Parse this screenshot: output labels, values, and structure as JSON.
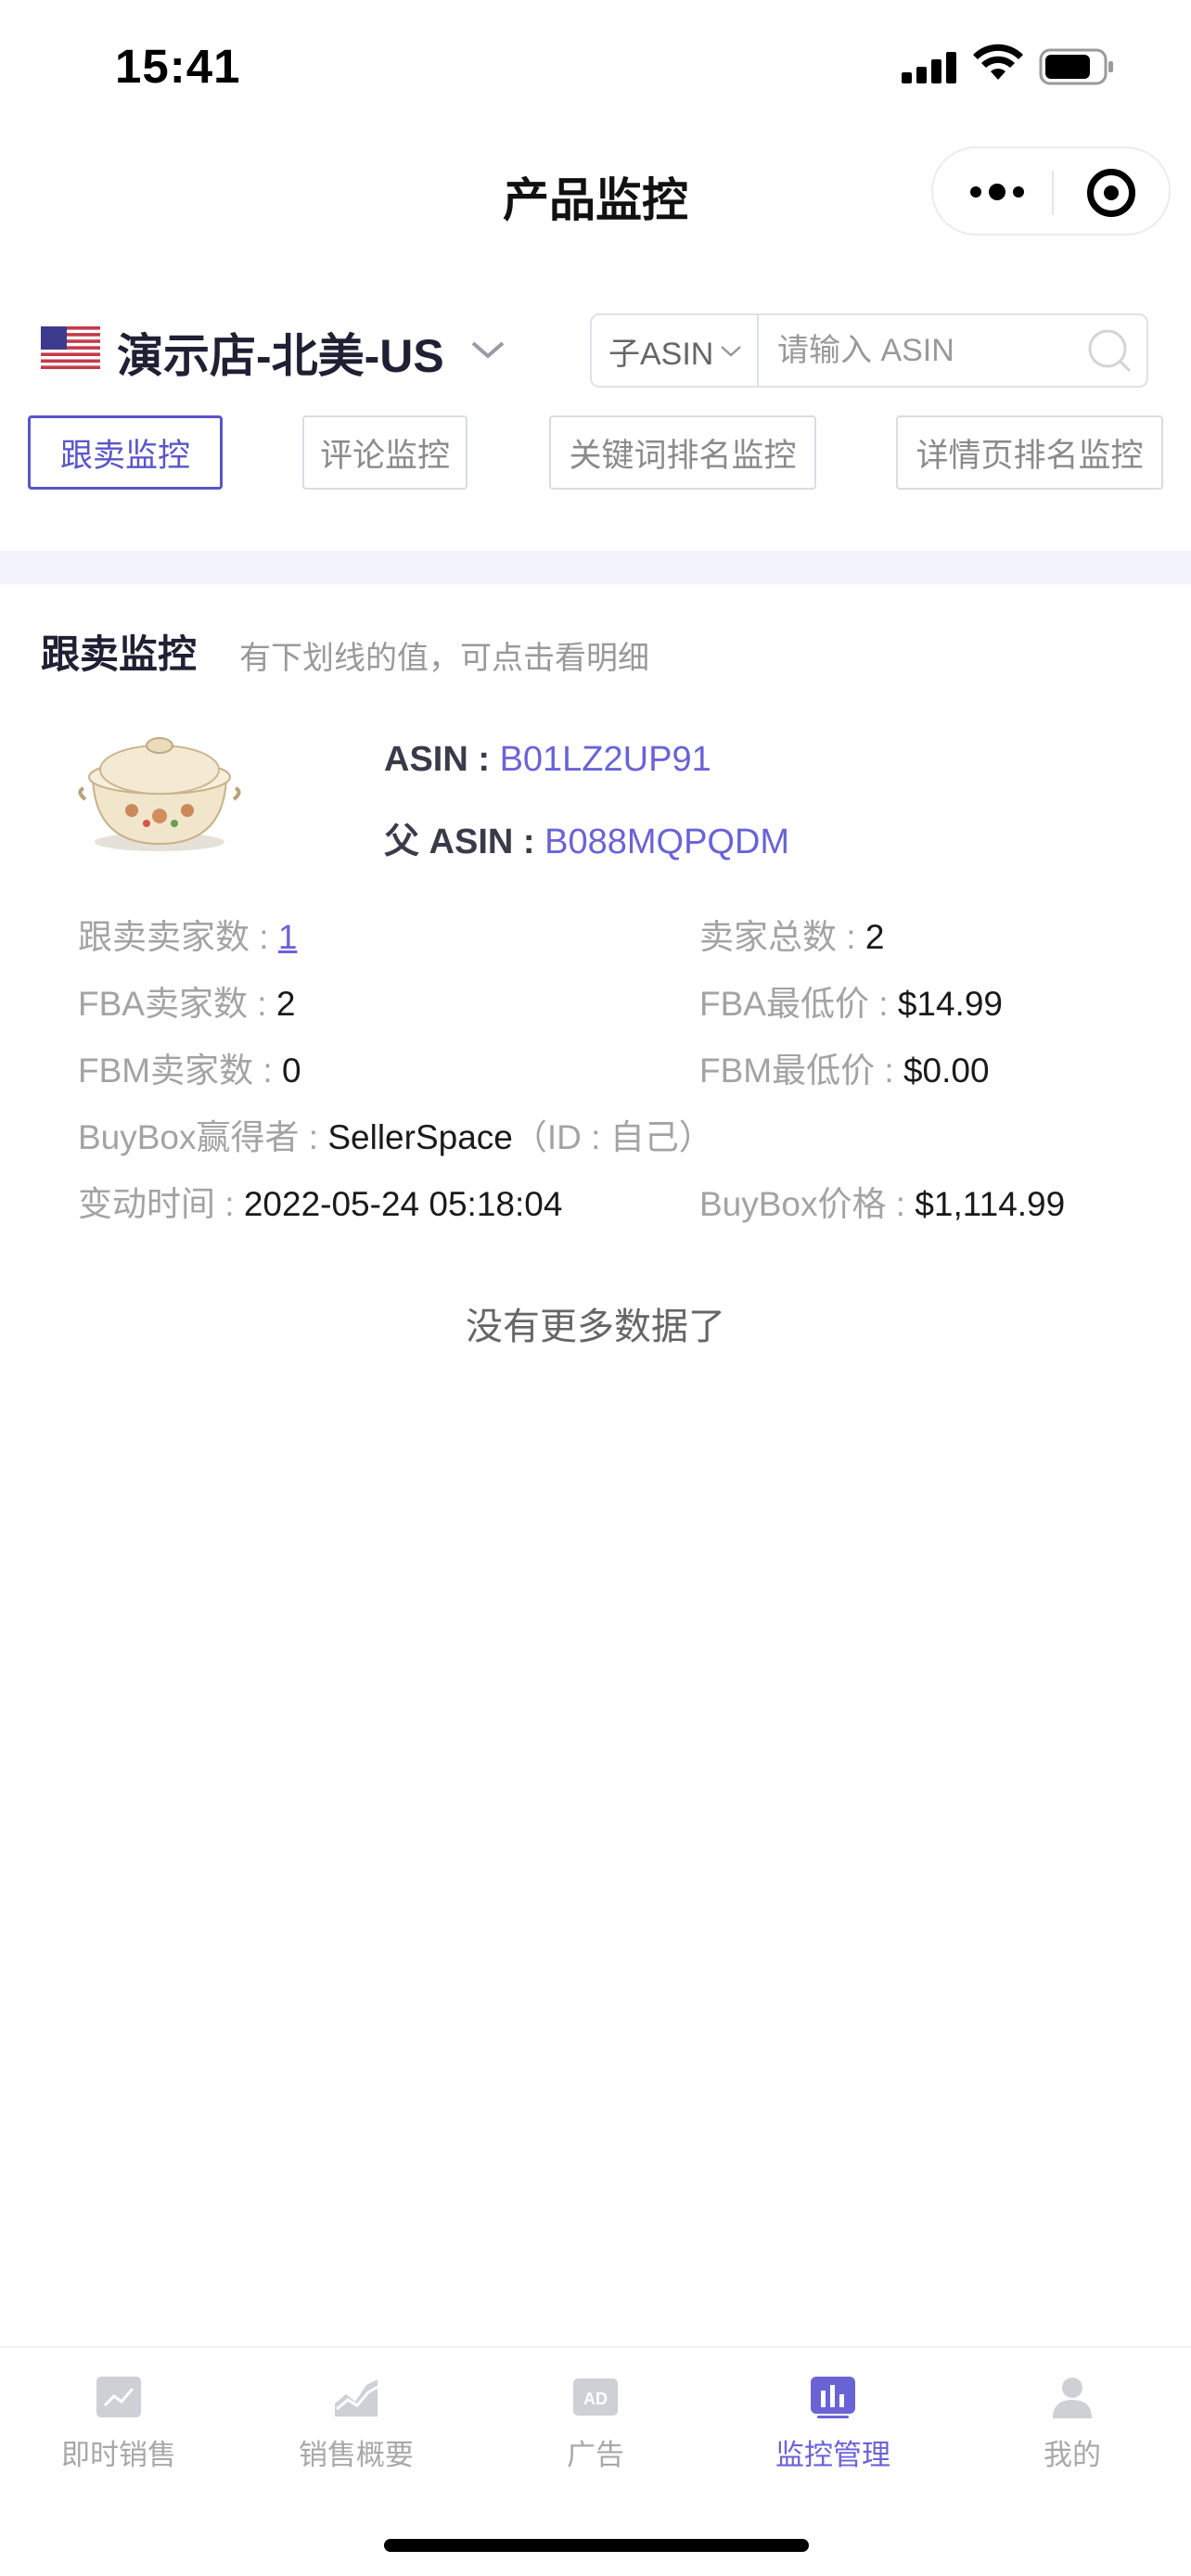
{
  "status_bar": {
    "time": "15:41"
  },
  "nav": {
    "title": "产品监控"
  },
  "store": {
    "name": "演示店-北美-US"
  },
  "search": {
    "type_label": "子ASIN",
    "placeholder": "请输入 ASIN"
  },
  "tabs": [
    {
      "label": "跟卖监控",
      "active": true
    },
    {
      "label": "评论监控",
      "active": false
    },
    {
      "label": "关键词排名监控",
      "active": false
    },
    {
      "label": "详情页排名监控",
      "active": false
    }
  ],
  "section": {
    "title": "跟卖监控",
    "hint": "有下划线的值，可点击看明细"
  },
  "product": {
    "asin_label": "ASIN :",
    "asin": "B01LZ2UP91",
    "parent_asin_label": "父 ASIN :",
    "parent_asin": "B088MQPQDM"
  },
  "stats": {
    "follow_sellers_label": "跟卖卖家数 : ",
    "follow_sellers": "1",
    "total_sellers_label": "卖家总数 : ",
    "total_sellers": "2",
    "fba_sellers_label": "FBA卖家数 : ",
    "fba_sellers": "2",
    "fba_lowest_label": "FBA最低价 : ",
    "fba_lowest": "$14.99",
    "fbm_sellers_label": "FBM卖家数 : ",
    "fbm_sellers": "0",
    "fbm_lowest_label": "FBM最低价 : ",
    "fbm_lowest": "$0.00",
    "buybox_winner_label": "BuyBox赢得者 : ",
    "buybox_winner": "SellerSpace",
    "buybox_winner_note": "（ID : 自己）",
    "change_time_label": "变动时间 : ",
    "change_time": "2022-05-24 05:18:04",
    "buybox_price_label": "BuyBox价格 : ",
    "buybox_price": "$1,114.99"
  },
  "list_end": "没有更多数据了",
  "tabbar": [
    {
      "label": "即时销售",
      "icon": "realtime-chart-icon",
      "active": false
    },
    {
      "label": "销售概要",
      "icon": "area-chart-icon",
      "active": false
    },
    {
      "label": "广告",
      "icon": "ad-icon",
      "active": false
    },
    {
      "label": "监控管理",
      "icon": "monitor-bar-icon",
      "active": true
    },
    {
      "label": "我的",
      "icon": "person-icon",
      "active": false
    }
  ],
  "colors": {
    "accent": "#6a63d6",
    "tab_active_border": "#5a55c8",
    "band": "#f2f3fb"
  }
}
